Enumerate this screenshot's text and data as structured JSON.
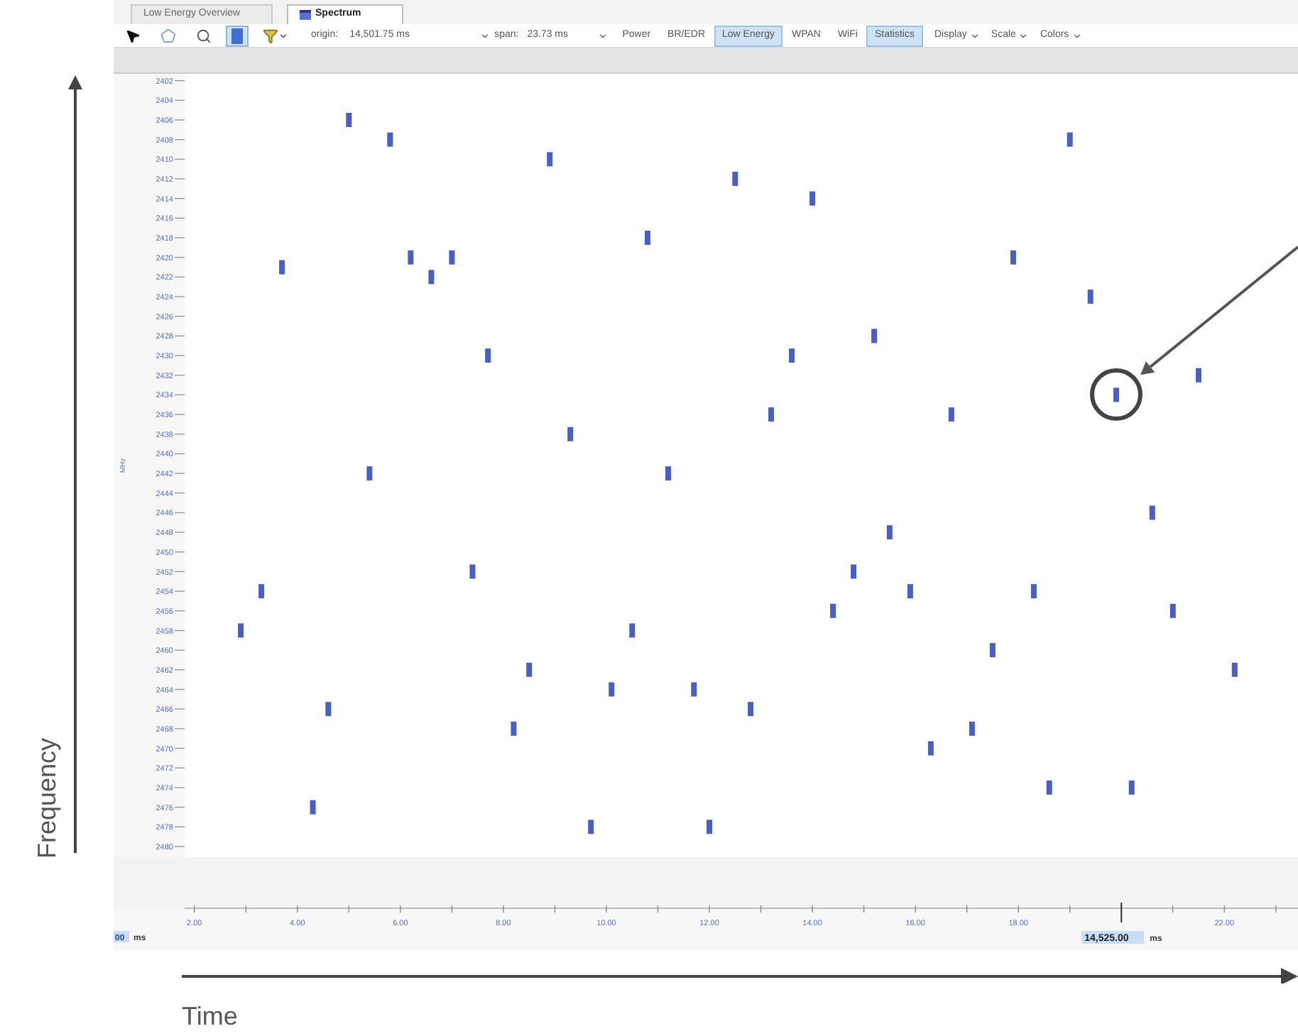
{
  "annotations": {
    "vertical_label": "Frequency",
    "horizontal_label": "Time"
  },
  "tabs": [
    {
      "label": "Low Energy Overview",
      "selected": false
    },
    {
      "label": "Spectrum",
      "selected": true
    }
  ],
  "toolbar": {
    "tools": [
      {
        "kind": "pointer",
        "selected": false
      },
      {
        "kind": "shape",
        "selected": false
      },
      {
        "kind": "zoom",
        "selected": false
      },
      {
        "kind": "block",
        "selected": true
      },
      {
        "kind": "filter",
        "selected": false
      }
    ],
    "origin_label": "origin:",
    "origin_value": "14,501.75 ms",
    "span_label": "span:",
    "span_value": "23.73 ms",
    "power_label": "Power",
    "filters": [
      {
        "label": "BR/EDR",
        "selected": false
      },
      {
        "label": "Low Energy",
        "selected": true
      },
      {
        "label": "WPAN",
        "selected": false
      },
      {
        "label": "WiFi",
        "selected": false
      },
      {
        "label": "Statistics",
        "selected": true
      }
    ],
    "menus": [
      "Display",
      "Scale",
      "Colors"
    ]
  },
  "chart": {
    "start_value": "00",
    "start_unit": "ms",
    "cursor_value": "14,525.00",
    "cursor_unit": "ms",
    "chart_data": {
      "type": "scatter",
      "ylabel": "MHz",
      "xlim": [
        1.81,
        23.43
      ],
      "ylim": [
        2480.8,
        2401.3
      ],
      "xticks": [
        {
          "value": 2,
          "label": "2.00"
        },
        {
          "value": 4,
          "label": "4.00"
        },
        {
          "value": 6,
          "label": "6.00"
        },
        {
          "value": 8,
          "label": "8.00"
        },
        {
          "value": 10,
          "label": "10.00"
        },
        {
          "value": 12,
          "label": "12.00"
        },
        {
          "value": 14,
          "label": "14.00"
        },
        {
          "value": 16,
          "label": "16.00"
        },
        {
          "value": 18,
          "label": "18.00"
        },
        {
          "value": 22,
          "label": "22.00"
        }
      ],
      "yticks": [
        {
          "value": 2402,
          "label": "2402"
        },
        {
          "value": 2404,
          "label": "2404"
        },
        {
          "value": 2406,
          "label": "2406"
        },
        {
          "value": 2408,
          "label": "2408"
        },
        {
          "value": 2410,
          "label": "2410"
        },
        {
          "value": 2412,
          "label": "2412"
        },
        {
          "value": 2414,
          "label": "2414"
        },
        {
          "value": 2416,
          "label": "2416"
        },
        {
          "value": 2418,
          "label": "2418"
        },
        {
          "value": 2420,
          "label": "2420"
        },
        {
          "value": 2422,
          "label": "2422"
        },
        {
          "value": 2424,
          "label": "2424"
        },
        {
          "value": 2426,
          "label": "2426"
        },
        {
          "value": 2428,
          "label": "2428"
        },
        {
          "value": 2430,
          "label": "2430"
        },
        {
          "value": 2432,
          "label": "2432"
        },
        {
          "value": 2434,
          "label": "2434"
        },
        {
          "value": 2436,
          "label": "2436"
        },
        {
          "value": 2438,
          "label": "2438"
        },
        {
          "value": 2440,
          "label": "2440"
        },
        {
          "value": 2442,
          "label": "2442"
        },
        {
          "value": 2444,
          "label": "2444"
        },
        {
          "value": 2446,
          "label": "2446"
        },
        {
          "value": 2448,
          "label": "2448"
        },
        {
          "value": 2450,
          "label": "2450"
        },
        {
          "value": 2452,
          "label": "2452"
        },
        {
          "value": 2454,
          "label": "2454"
        },
        {
          "value": 2456,
          "label": "2456"
        },
        {
          "value": 2458,
          "label": "2458"
        },
        {
          "value": 2460,
          "label": "2460"
        },
        {
          "value": 2462,
          "label": "2462"
        },
        {
          "value": 2464,
          "label": "2464"
        },
        {
          "value": 2466,
          "label": "2466"
        },
        {
          "value": 2468,
          "label": "2468"
        },
        {
          "value": 2470,
          "label": "2470"
        },
        {
          "value": 2472,
          "label": "2472"
        },
        {
          "value": 2474,
          "label": "2474"
        },
        {
          "value": 2476,
          "label": "2476"
        },
        {
          "value": 2478,
          "label": "2478"
        },
        {
          "value": 2480,
          "label": "2480"
        }
      ],
      "series": [
        {
          "color": "#4a5fc4",
          "x": [
            5.0,
            5.8,
            8.9,
            19.0,
            12.5,
            14.0,
            10.8,
            17.9,
            3.7,
            6.2,
            6.6,
            7.0,
            19.4,
            7.7,
            13.6,
            15.2,
            19.9,
            21.5,
            16.7,
            13.2,
            9.3,
            5.4,
            11.2,
            20.6,
            15.5,
            14.8,
            7.4,
            3.3,
            15.9,
            18.3,
            2.9,
            14.4,
            10.5,
            21.0,
            17.5,
            8.5,
            10.1,
            11.7,
            12.8,
            22.2,
            4.6,
            8.2,
            17.1,
            16.3,
            20.2,
            18.6,
            4.3,
            9.7,
            12.0
          ],
          "values": [
            2406,
            2408,
            2410,
            2408,
            2412,
            2414,
            2418,
            2420,
            2421,
            2420,
            2422,
            2420,
            2424,
            2430,
            2430,
            2428,
            2434,
            2432,
            2436,
            2436,
            2438,
            2442,
            2442,
            2446,
            2448,
            2452,
            2452,
            2454,
            2454,
            2454,
            2458,
            2456,
            2458,
            2456,
            2460,
            2462,
            2464,
            2464,
            2466,
            2462,
            2466,
            2468,
            2468,
            2470,
            2474,
            2474,
            2476,
            2478,
            2478
          ]
        }
      ]
    }
  }
}
